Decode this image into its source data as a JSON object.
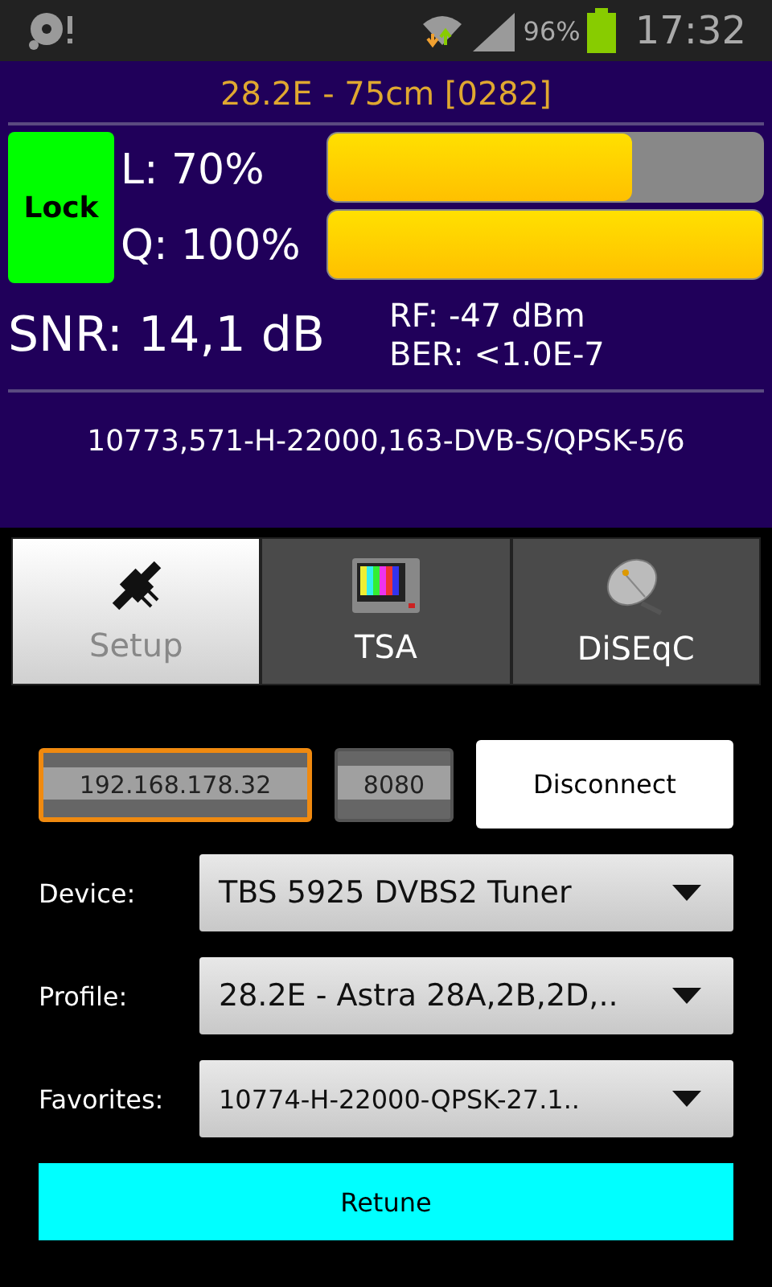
{
  "status_bar": {
    "battery": "96%",
    "time": "17:32"
  },
  "header": {
    "title": "28.2E - 75cm [0282]"
  },
  "signal": {
    "lock": {
      "label": "Lock",
      "locked": true
    },
    "meters": [
      {
        "label": "L: 70%",
        "level": 0.7
      },
      {
        "label": "Q: 100%",
        "level": 1.0
      }
    ],
    "snr": "SNR: 14,1 dB",
    "rf": "RF: -47 dBm",
    "ber": "BER: <1.0E-7"
  },
  "transponder": "10773,571-H-22000,163-DVB-S/QPSK-5/6",
  "tabs": [
    {
      "label": "Setup",
      "kind": "setup",
      "selected": true
    },
    {
      "label": "TSA",
      "kind": "tsa",
      "selected": false
    },
    {
      "label": "DiSEqC",
      "kind": "diseqc",
      "selected": false
    }
  ],
  "connection": {
    "host": {
      "value": "192.168.178.32",
      "focused": true
    },
    "port": {
      "value": "8080",
      "focused": false
    },
    "button": "Disconnect"
  },
  "selectors": [
    {
      "label": "Device:",
      "value": "TBS 5925 DVBS2 Tuner"
    },
    {
      "label": "Profile:",
      "value": "28.2E - Astra 28A,2B,2D,.."
    },
    {
      "label": "Favorites:",
      "value": "10774-H-22000-QPSK-27.1.."
    }
  ],
  "action_button": "Retune"
}
